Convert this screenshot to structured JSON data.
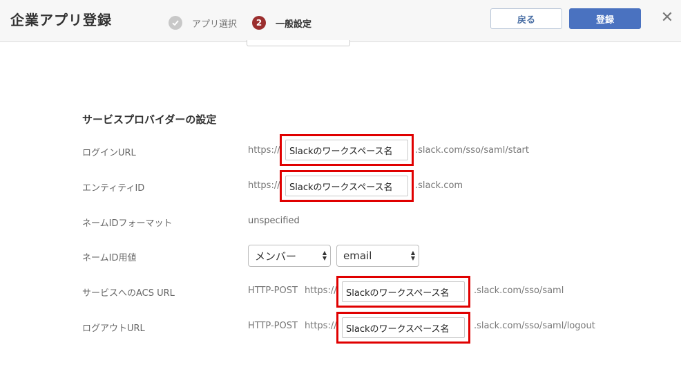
{
  "header": {
    "title": "企業アプリ登録",
    "steps": [
      {
        "icon": "check-icon",
        "label": "アプリ選択",
        "state": "done"
      },
      {
        "number": "2",
        "label": "一般設定",
        "state": "current"
      }
    ],
    "back_label": "戻る",
    "register_label": "登録",
    "close_symbol": "✕"
  },
  "section": {
    "title": "サービスプロバイダーの設定"
  },
  "rows": {
    "login_url": {
      "label": "ログインURL",
      "prefix": "https://",
      "value": "Slackのワークスペース名",
      "suffix": ".slack.com/sso/saml/start"
    },
    "entity_id": {
      "label": "エンティティID",
      "prefix": "https://",
      "value": "Slackのワークスペース名",
      "suffix": ".slack.com"
    },
    "nameid_format": {
      "label": "ネームIDフォーマット",
      "value": "unspecified"
    },
    "nameid_value": {
      "label": "ネームID用値",
      "select1": "メンバー",
      "select2": "email"
    },
    "acs_url": {
      "label": "サービスへのACS URL",
      "method": "HTTP-POST",
      "prefix": "https://",
      "value": "Slackのワークスペース名",
      "suffix": ".slack.com/sso/saml"
    },
    "logout_url": {
      "label": "ログアウトURL",
      "method": "HTTP-POST",
      "prefix": "https://",
      "value": "Slackのワークスペース名",
      "suffix": ".slack.com/sso/saml/logout"
    }
  },
  "colors": {
    "accent": "#4a72c0",
    "step_current": "#9b2e2e",
    "highlight": "#e00000"
  }
}
